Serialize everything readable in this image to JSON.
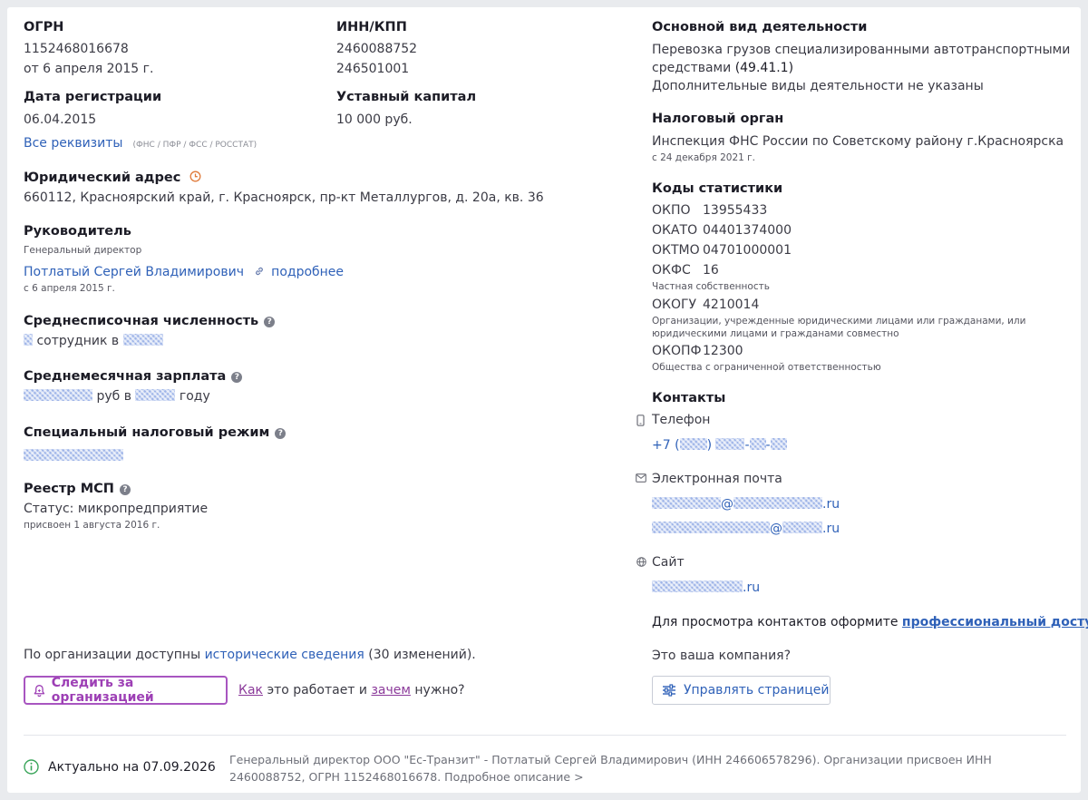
{
  "left_top": {
    "ogrn_label": "ОГРН",
    "ogrn_value": "1152468016678",
    "ogrn_date": "от 6 апреля 2015 г.",
    "reg_label": "Дата регистрации",
    "reg_value": "06.04.2015",
    "all_requisites": "Все реквизиты",
    "requisites_note": "(ФНС / ПФР / ФСС / РОССТАТ)"
  },
  "mid_top": {
    "inn_label": "ИНН/КПП",
    "inn_value": "2460088752",
    "kpp_value": "246501001",
    "capital_label": "Уставный капитал",
    "capital_value": "10 000 руб."
  },
  "address": {
    "label": "Юридический адрес",
    "value": "660112, Красноярский край, г. Красноярск, пр-кт Металлургов, д. 20а, кв. 36"
  },
  "director": {
    "label": "Руководитель",
    "role": "Генеральный директор",
    "name": "Потлатый Сергей Владимирович",
    "more": "подробнее",
    "since": "с 6 апреля 2015 г."
  },
  "headcount": {
    "label": "Среднесписочная численность",
    "text1": "сотрудник в"
  },
  "salary": {
    "label": "Среднемесячная зарплата",
    "text1": "руб в",
    "text2": "году"
  },
  "tax_regime": {
    "label": "Специальный налоговый режим"
  },
  "msp": {
    "label": "Реестр МСП",
    "status": "Статус: микропредприятие",
    "since": "присвоен 1 августа 2016 г."
  },
  "history": {
    "prefix": "По организации доступны",
    "link": "исторические сведения",
    "suffix": "(30 изменений)."
  },
  "follow": {
    "label": "Следить за организацией",
    "how": "Как",
    "works": "это работает и",
    "why": "зачем",
    "need": "нужно?"
  },
  "activity": {
    "label": "Основной вид деятельности",
    "line1": "Перевозка грузов специализированными автотранспортными",
    "line2": "средствами",
    "code": "(49.41.1)",
    "additional": "Дополнительные виды деятельности не указаны"
  },
  "tax_office": {
    "label": "Налоговый орган",
    "value": "Инспекция ФНС России по Советскому району г.Красноярска",
    "since": "с 24 декабря 2021 г."
  },
  "stats": {
    "label": "Коды статистики",
    "okpo_k": "ОКПО",
    "okpo_v": "13955433",
    "okato_k": "ОКАТО",
    "okato_v": "04401374000",
    "oktmo_k": "ОКТМО",
    "oktmo_v": "04701000001",
    "okfs_k": "ОКФС",
    "okfs_v": "16",
    "okfs_note": "Частная собственность",
    "okogu_k": "ОКОГУ",
    "okogu_v": "4210014",
    "okogu_note1": "Организации, учрежденные юридическими лицами или гражданами, или",
    "okogu_note2": "юридическими лицами и гражданами совместно",
    "okopf_k": "ОКОПФ",
    "okopf_v": "12300",
    "okopf_note": "Общества с ограниченной ответственностью"
  },
  "contacts": {
    "label": "Контакты",
    "phone_label": "Телефон",
    "phone_prefix": "+7 (",
    "email_label": "Электронная почта",
    "email_at": "@",
    "email_tld": ".ru",
    "site_label": "Сайт",
    "site_tld": ".ru",
    "pro_text": "Для просмотра контактов оформите",
    "pro_link": "профессиональный доступ"
  },
  "company": {
    "question": "Это ваша компания?",
    "manage": "Управлять страницей"
  },
  "footer": {
    "actual": "Актуально на 07.09.2026",
    "description": "Генеральный директор ООО \"Ес-Транзит\" - Потлатый Сергей Владимирович (ИНН 246606578296). Организации присвоен ИНН 2460088752, ОГРН 1152468016678. Подробное описание >"
  },
  "colors": {
    "link": "#2f61b8",
    "accent": "#a855c0",
    "masked": "#9fb5e8"
  },
  "icons": [
    "clock-icon",
    "question-icon",
    "link-icon",
    "phone-icon",
    "mail-icon",
    "globe-icon",
    "bell-icon",
    "sliders-icon",
    "info-icon"
  ]
}
